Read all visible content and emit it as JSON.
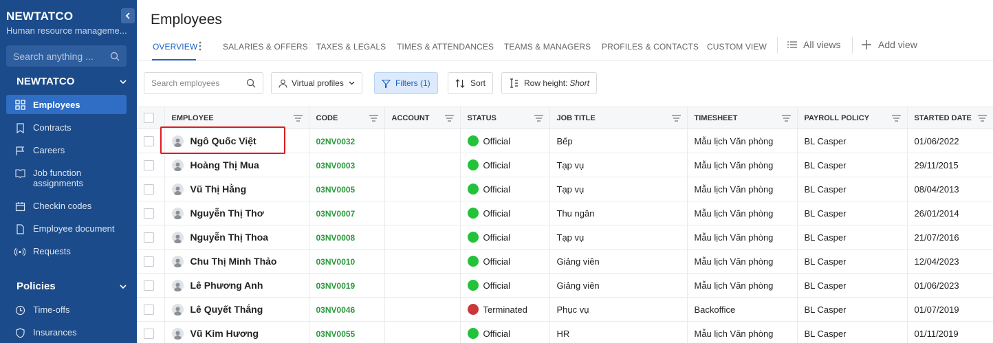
{
  "sidebar": {
    "brand": "NEWTATCO",
    "brand_subtitle": "Human resource manageme...",
    "search_placeholder": "Search anything ...",
    "group1": "NEWTATCO",
    "items": [
      {
        "label": "Employees",
        "icon": "grid-icon",
        "active": true
      },
      {
        "label": "Contracts",
        "icon": "bookmark-icon"
      },
      {
        "label": "Careers",
        "icon": "flag-icon"
      },
      {
        "label": "Job function assignments",
        "icon": "book-icon"
      },
      {
        "label": "Checkin codes",
        "icon": "calendar-icon"
      },
      {
        "label": "Employee document",
        "icon": "document-icon"
      },
      {
        "label": "Requests",
        "icon": "broadcast-icon"
      }
    ],
    "group2": "Policies",
    "items2": [
      {
        "label": "Time-offs",
        "icon": "clock-icon"
      },
      {
        "label": "Insurances",
        "icon": "shield-icon"
      }
    ]
  },
  "header": {
    "title": "Employees",
    "tabs": [
      "OVERVIEW",
      "SALARIES & OFFERS",
      "TAXES & LEGALS",
      "TIMES & ATTENDANCES",
      "TEAMS & MANAGERS",
      "PROFILES & CONTACTS",
      "CUSTOM VIEW"
    ],
    "all_views": "All views",
    "add_view": "Add view"
  },
  "toolbar": {
    "search_placeholder": "Search employees",
    "virtual_profiles": "Virtual profiles",
    "filters": "Filters (1)",
    "sort": "Sort",
    "row_height_label": "Row height:",
    "row_height_value": "Short"
  },
  "table": {
    "columns": [
      "EMPLOYEE",
      "CODE",
      "ACCOUNT",
      "STATUS",
      "JOB TITLE",
      "TIMESHEET",
      "PAYROLL POLICY",
      "STARTED DATE"
    ],
    "rows": [
      {
        "name": "Ngô Quốc Việt",
        "code": "02NV0032",
        "account": "",
        "status": "Official",
        "job": "Bếp",
        "timesheet": "Mẫu lịch Văn phòng",
        "payroll": "BL Casper",
        "date": "01/06/2022"
      },
      {
        "name": "Hoàng Thị Mua",
        "code": "03NV0003",
        "account": "",
        "status": "Official",
        "job": "Tạp vụ",
        "timesheet": "Mẫu lịch Văn phòng",
        "payroll": "BL Casper",
        "date": "29/11/2015"
      },
      {
        "name": "Vũ Thị Hằng",
        "code": "03NV0005",
        "account": "",
        "status": "Official",
        "job": "Tạp vụ",
        "timesheet": "Mẫu lịch Văn phòng",
        "payroll": "BL Casper",
        "date": "08/04/2013"
      },
      {
        "name": "Nguyễn Thị Thơ",
        "code": "03NV0007",
        "account": "",
        "status": "Official",
        "job": "Thu ngân",
        "timesheet": "Mẫu lịch Văn phòng",
        "payroll": "BL Casper",
        "date": "26/01/2014"
      },
      {
        "name": "Nguyễn Thị Thoa",
        "code": "03NV0008",
        "account": "",
        "status": "Official",
        "job": "Tạp vụ",
        "timesheet": "Mẫu lịch Văn phòng",
        "payroll": "BL Casper",
        "date": "21/07/2016"
      },
      {
        "name": "Chu Thị Minh Thảo",
        "code": "03NV0010",
        "account": "",
        "status": "Official",
        "job": "Giảng viên",
        "timesheet": "Mẫu lịch Văn phòng",
        "payroll": "BL Casper",
        "date": "12/04/2023"
      },
      {
        "name": "Lê Phương Anh",
        "code": "03NV0019",
        "account": "",
        "status": "Official",
        "job": "Giảng viên",
        "timesheet": "Mẫu lịch Văn phòng",
        "payroll": "BL Casper",
        "date": "01/06/2023"
      },
      {
        "name": "Lê Quyết Thắng",
        "code": "03NV0046",
        "account": "",
        "status": "Terminated",
        "job": "Phục vụ",
        "timesheet": "Backoffice",
        "payroll": "BL Casper",
        "date": "01/07/2019"
      },
      {
        "name": "Vũ Kim Hương",
        "code": "03NV0055",
        "account": "",
        "status": "Official",
        "job": "HR",
        "timesheet": "Mẫu lịch Văn phòng",
        "payroll": "BL Casper",
        "date": "01/11/2019"
      }
    ]
  },
  "colors": {
    "official": "#22c33a",
    "terminated": "#c9383a",
    "accent": "#1d62c8",
    "sidebar": "#1b4b8a"
  }
}
